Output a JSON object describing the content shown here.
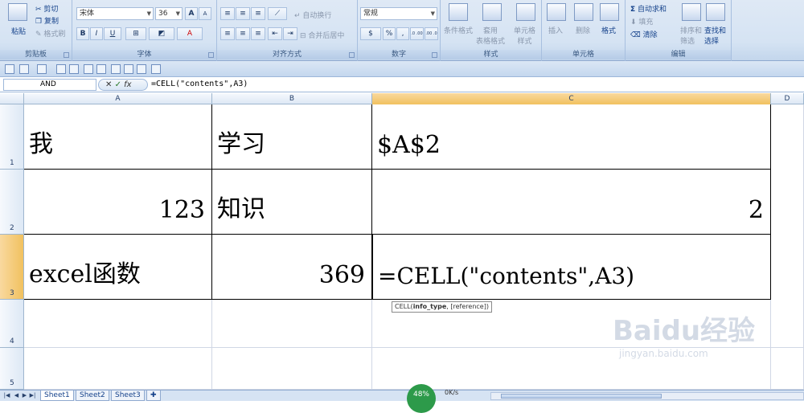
{
  "ribbon": {
    "clipboard": {
      "label": "剪贴板",
      "paste": "粘贴",
      "cut": "剪切",
      "copy": "复制",
      "format_painter": "格式刷"
    },
    "font": {
      "label": "字体",
      "font_name": "宋体",
      "font_size": "36",
      "bold": "B",
      "italic": "I",
      "underline": "U",
      "grow": "A",
      "shrink": "A"
    },
    "alignment": {
      "label": "对齐方式",
      "wrap_text": "自动换行",
      "merge_center": "合并后居中"
    },
    "number": {
      "label": "数字",
      "format": "常规",
      "percent": "%",
      "comma": ",",
      "inc": ".0 .00",
      "dec": ".00 .0"
    },
    "styles": {
      "label": "样式",
      "conditional": "条件格式",
      "table": "套用\n表格格式",
      "cell_styles": "单元格\n样式"
    },
    "cells": {
      "label": "单元格",
      "insert": "插入",
      "delete": "删除",
      "format": "格式"
    },
    "editing": {
      "label": "编辑",
      "autosum": "自动求和",
      "fill": "填充",
      "clear": "清除",
      "sort_filter": "排序和\n筛选",
      "find_select": "查找和\n选择"
    }
  },
  "formula_bar": {
    "name_box": "AND",
    "fx": "fx",
    "formula": "=CELL(\"contents\",A3)"
  },
  "columns": [
    "A",
    "B",
    "C",
    "D"
  ],
  "rows": [
    "1",
    "2",
    "3",
    "4",
    "5"
  ],
  "cells": {
    "A1": "我",
    "B1": "学习",
    "C1": "$A$2",
    "A2": "123",
    "B2": "知识",
    "C2": "2",
    "A3": "excel函数",
    "B3": "369",
    "C3": "=CELL(\"contents\",A3)"
  },
  "tooltip": {
    "func": "CELL(",
    "arg1": "info_type",
    "rest": ", [reference])"
  },
  "sheets": [
    "Sheet1",
    "Sheet2",
    "Sheet3"
  ],
  "status": {
    "percent": "48%",
    "speed": "0K/s"
  },
  "watermark": {
    "brand": "Baidu经验",
    "url": "jingyan.baidu.com"
  }
}
